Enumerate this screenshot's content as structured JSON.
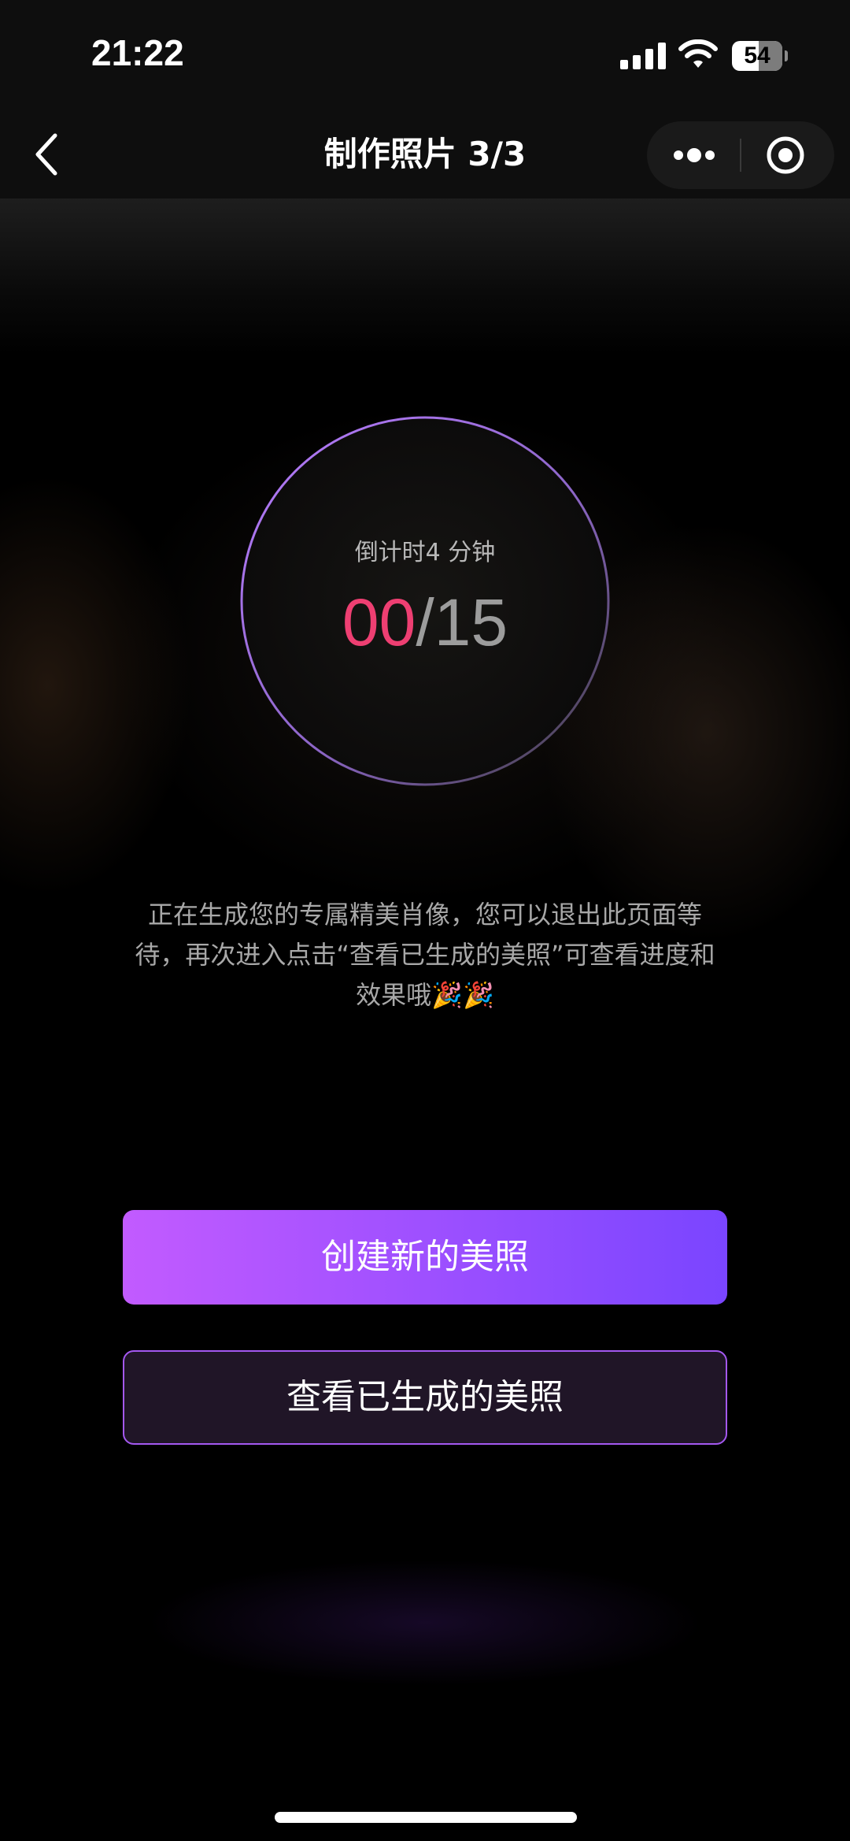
{
  "status_bar": {
    "time": "21:22",
    "battery_level": "54"
  },
  "nav": {
    "title": "制作照片 3/3",
    "icons": [
      "back-icon",
      "more-icon",
      "close-icon"
    ]
  },
  "countdown": {
    "label": "倒计时4 分钟",
    "current": "00",
    "separator": "/",
    "total": "15"
  },
  "message": {
    "text": "正在生成您的专属精美肖像，您可以退出此页面等待，再次进入点击“查看已生成的美照”可查看进度和效果哦🎉🎉"
  },
  "buttons": {
    "create_label": "创建新的美照",
    "view_label": "查看已生成的美照"
  },
  "colors": {
    "accent_pink": "#ee3f72",
    "button_gradient_start": "#c25bff",
    "button_gradient_end": "#7a45ff",
    "outline_purple": "#a458f0"
  }
}
